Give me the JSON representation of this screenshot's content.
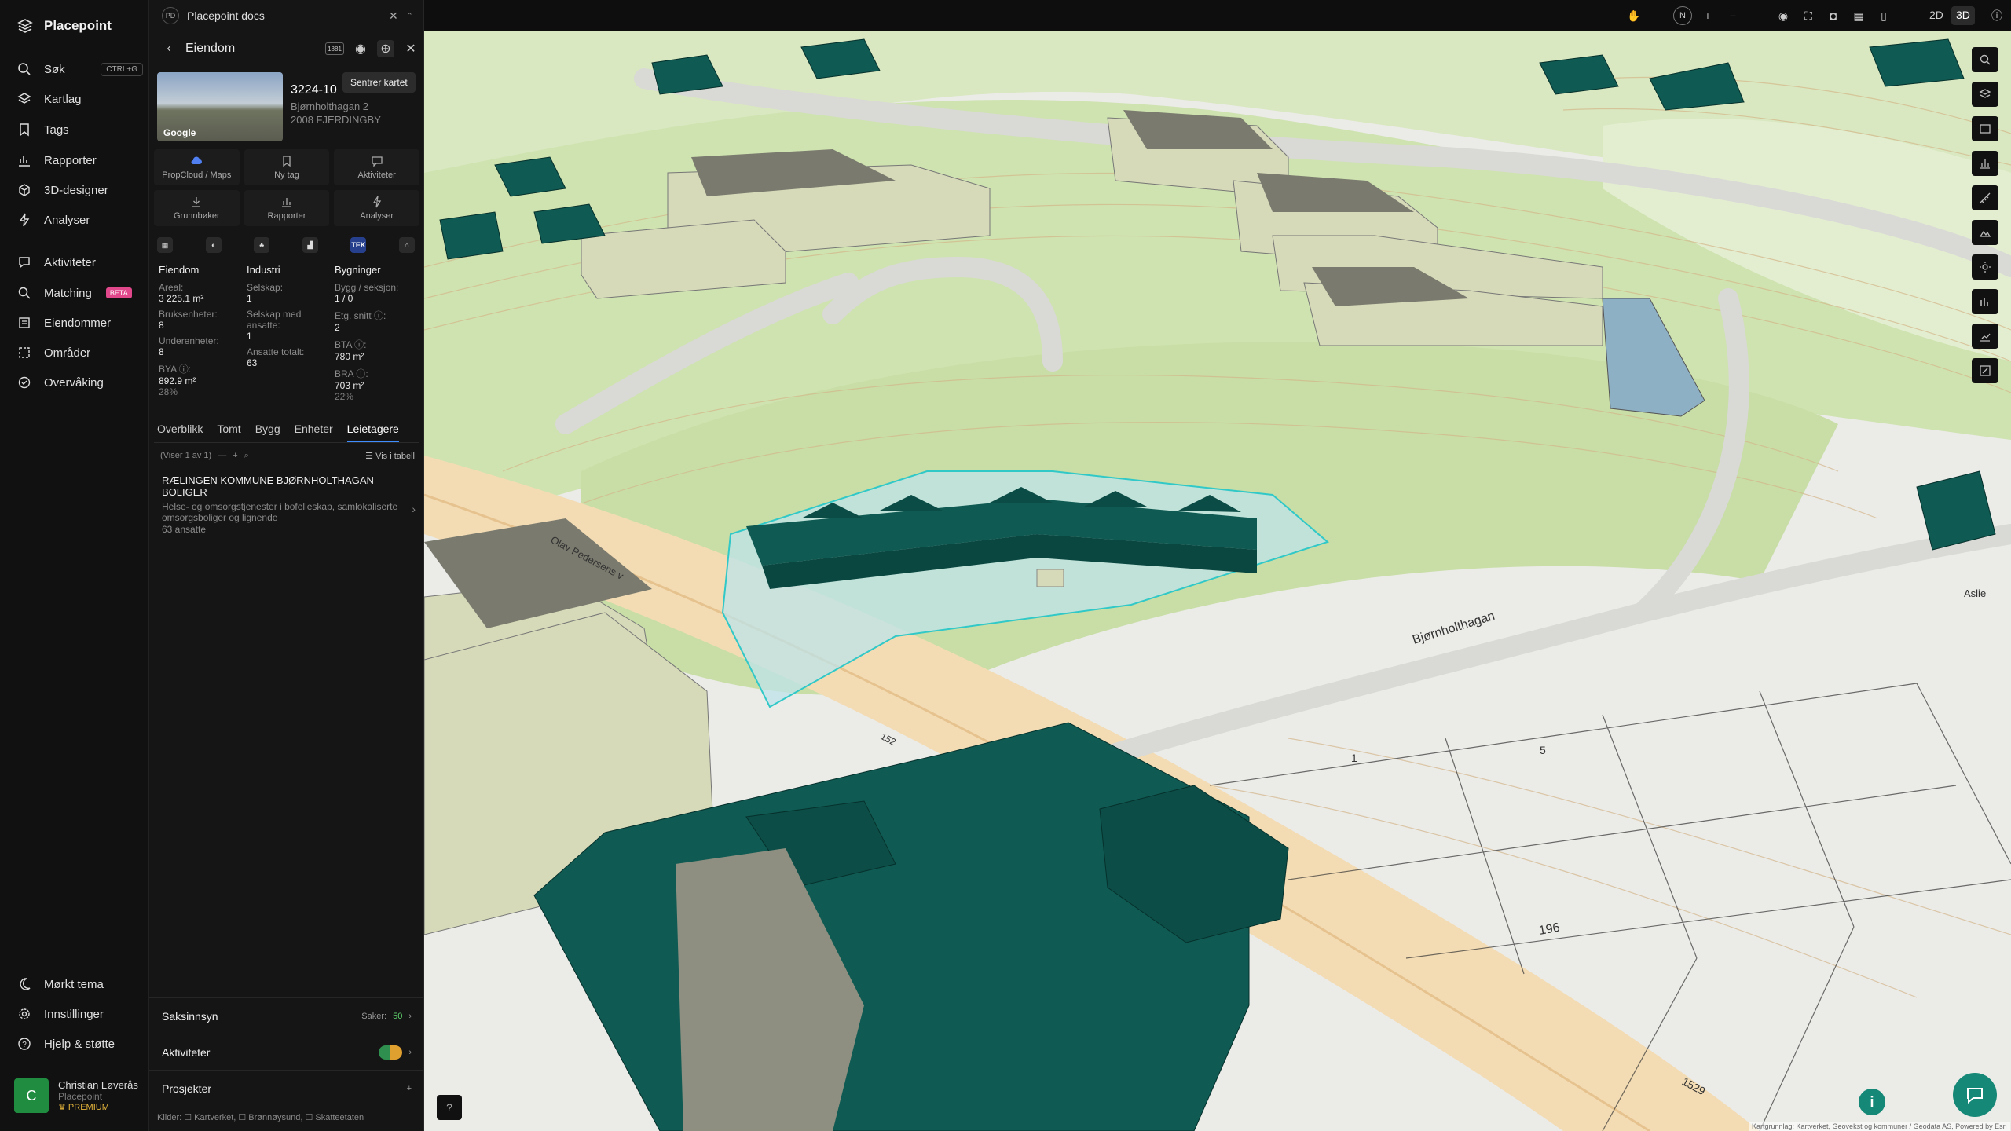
{
  "app": {
    "name": "Placepoint"
  },
  "nav": {
    "search": "Søk",
    "search_kbd": "CTRL+G",
    "items": [
      {
        "label": "Kartlag"
      },
      {
        "label": "Tags"
      },
      {
        "label": "Rapporter"
      },
      {
        "label": "3D-designer"
      },
      {
        "label": "Analyser"
      },
      {
        "label": "Aktiviteter"
      },
      {
        "label": "Matching",
        "badge": "BETA"
      },
      {
        "label": "Eiendommer"
      },
      {
        "label": "Områder"
      },
      {
        "label": "Overvåking"
      }
    ],
    "bottom": [
      {
        "label": "Mørkt tema"
      },
      {
        "label": "Innstillinger"
      },
      {
        "label": "Hjelp & støtte"
      }
    ],
    "user": {
      "initial": "C",
      "name": "Christian Løverås",
      "org": "Placepoint",
      "plan": "PREMIUM"
    }
  },
  "panel": {
    "doc_tab": {
      "badge": "PD",
      "title": "Placepoint docs"
    },
    "header": {
      "title": "Eiendom",
      "tooltip": "Sentrer kartet"
    },
    "thumb_label": "Google",
    "property": {
      "id": "3224-10",
      "address": "Bjørnholthagan 2",
      "postal": "2008 FJERDINGBY"
    },
    "actions": [
      {
        "label": "PropCloud / Maps",
        "icon": "cloud-icon"
      },
      {
        "label": "Ny tag",
        "icon": "bookmark-icon"
      },
      {
        "label": "Aktiviteter",
        "icon": "chat-icon"
      },
      {
        "label": "Grunnbøker",
        "icon": "download-icon"
      },
      {
        "label": "Rapporter",
        "icon": "chart-icon"
      },
      {
        "label": "Analyser",
        "icon": "bolt-icon"
      }
    ],
    "tek_label": "TEK",
    "columns": {
      "eiendom": {
        "title": "Eiendom",
        "areal_k": "Areal:",
        "areal_v": "3 225.1 m²",
        "bruks_k": "Bruksenheter:",
        "bruks_v": "8",
        "under_k": "Underenheter:",
        "under_v": "8",
        "bya_k": "BYA ⓘ:",
        "bya_v": "892.9 m²",
        "bya_s": "28%"
      },
      "industri": {
        "title": "Industri",
        "selskap_k": "Selskap:",
        "selskap_v": "1",
        "ansatte_k": "Selskap med ansatte:",
        "ansatte_v": "1",
        "total_k": "Ansatte totalt:",
        "total_v": "63"
      },
      "bygninger": {
        "title": "Bygninger",
        "bygg_k": "Bygg / seksjon:",
        "bygg_v": "1 / 0",
        "etg_k": "Etg. snitt ⓘ:",
        "etg_v": "2",
        "bta_k": "BTA ⓘ:",
        "bta_v": "780 m²",
        "bra_k": "BRA ⓘ:",
        "bra_v": "703 m²",
        "bra_s": "22%"
      }
    },
    "tabs": [
      "Overblikk",
      "Tomt",
      "Bygg",
      "Enheter",
      "Leietagere"
    ],
    "active_tab": "Leietagere",
    "list_info": "(Viser 1 av 1)",
    "list_table": "Vis i tabell",
    "tenant": {
      "name": "RÆLINGEN KOMMUNE BJØRNHOLTHAGAN BOLIGER",
      "desc": "Helse- og omsorgstjenester i bofelleskap, samlokaliserte omsorgsboliger og lignende",
      "employees": "63 ansatte"
    },
    "sections": {
      "saksinnsyn": "Saksinnsyn",
      "saker_label": "Saker:",
      "saker_count": "50",
      "aktiviteter": "Aktiviteter",
      "prosjekter": "Prosjekter"
    },
    "sources": "Kilder: ☐ Kartverket, ☐ Brønnøysund, ☐ Skatteetaten"
  },
  "map": {
    "mode_2d": "2D",
    "mode_3d": "3D",
    "active_mode": "3D",
    "compass": "N",
    "road_labels": [
      "Bjørnholthagan",
      "Olav Pedersens v",
      "Aslie"
    ],
    "road_numbers": [
      "1529",
      "152"
    ],
    "plot_numbers": [
      "196",
      "5",
      "1"
    ],
    "attribution": "Kartgrunnlag: Kartverket, Geovekst og kommuner / Geodata AS, Powered by Esri",
    "colors": {
      "building_dark": "#0f5a52",
      "building_light": "#d6dab8",
      "selected": "#bde3ea"
    }
  }
}
